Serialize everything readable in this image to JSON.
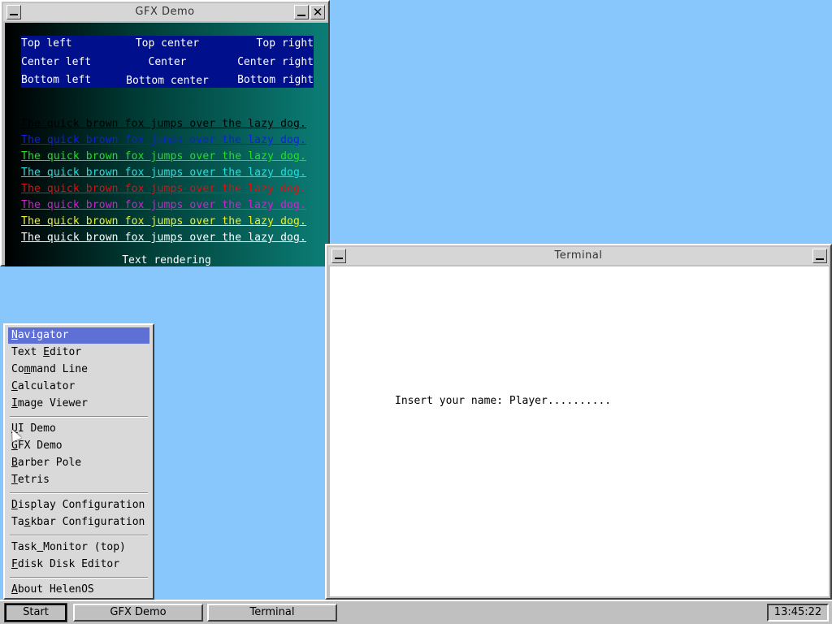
{
  "gfx_window": {
    "title": "GFX Demo",
    "align_labels": {
      "top_left": "Top left",
      "top_center": "Top center",
      "top_right": "Top right",
      "center_left": "Center left",
      "center": "Center",
      "center_right": "Center right",
      "bottom_left": "Bottom left",
      "bottom_center": "Bottom center",
      "bottom_right": "Bottom right"
    },
    "fox_lines": [
      {
        "text": "The quick brown fox jumps over the lazy dog.",
        "color": "#000000"
      },
      {
        "text": "The quick brown fox jumps over the lazy dog.",
        "color": "#1020e0"
      },
      {
        "text": "The quick brown fox jumps over the lazy dog.",
        "color": "#22e022"
      },
      {
        "text": "The quick brown fox jumps over the lazy dog.",
        "color": "#22e0e0"
      },
      {
        "text": "The quick brown fox jumps over the lazy dog.",
        "color": "#e01010"
      },
      {
        "text": "The quick brown fox jumps over the lazy dog.",
        "color": "#d022d0"
      },
      {
        "text": "The quick brown fox jumps over the lazy dog.",
        "color": "#f0f022"
      },
      {
        "text": "The quick brown fox jumps over the lazy dog.",
        "color": "#ffffff"
      }
    ],
    "caption": "Text rendering"
  },
  "terminal_window": {
    "title": "Terminal",
    "prompt": "Insert your name: Player.........."
  },
  "start_menu": {
    "items": [
      {
        "label": "Navigator",
        "selected": true
      },
      {
        "label": "Text Editor"
      },
      {
        "label": "Command Line"
      },
      {
        "label": "Calculator"
      },
      {
        "label": "Image Viewer"
      },
      {
        "label": "UI Demo"
      },
      {
        "label": "GFX Demo"
      },
      {
        "label": "Barber Pole"
      },
      {
        "label": "Tetris"
      },
      {
        "label": "Display Configuration"
      },
      {
        "label": "Taskbar Configuration"
      },
      {
        "label": "Task Monitor (top)"
      },
      {
        "label": "Fdisk Disk Editor"
      },
      {
        "label": "About HelenOS"
      }
    ]
  },
  "taskbar": {
    "start_label": "Start",
    "tasks": [
      "GFX Demo",
      "Terminal"
    ],
    "clock": "13:45:22"
  },
  "colors": {
    "desktop": "#87c7fb",
    "menu_selection": "#5e6fd6",
    "align_box": "#00108c"
  }
}
